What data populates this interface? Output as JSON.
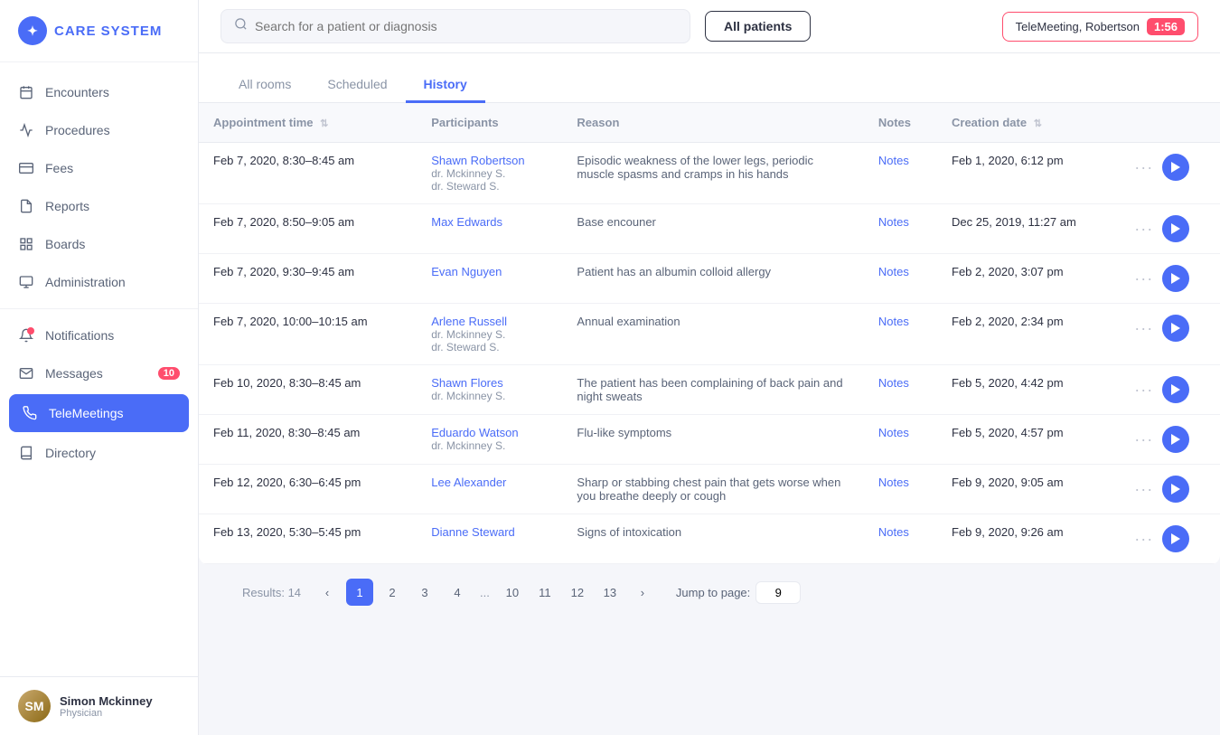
{
  "sidebar": {
    "logo_text": "CARE SYSTEM",
    "items": [
      {
        "id": "encounters",
        "label": "Encounters",
        "icon": "calendar-icon",
        "active": false
      },
      {
        "id": "procedures",
        "label": "Procedures",
        "icon": "activity-icon",
        "active": false
      },
      {
        "id": "fees",
        "label": "Fees",
        "icon": "card-icon",
        "active": false
      },
      {
        "id": "reports",
        "label": "Reports",
        "icon": "file-icon",
        "active": false
      },
      {
        "id": "boards",
        "label": "Boards",
        "icon": "grid-icon",
        "active": false
      },
      {
        "id": "administration",
        "label": "Administration",
        "icon": "monitor-icon",
        "active": false
      },
      {
        "id": "notifications",
        "label": "Notifications",
        "icon": "bell-icon",
        "active": false
      },
      {
        "id": "messages",
        "label": "Messages",
        "icon": "mail-icon",
        "active": false,
        "badge": "10"
      },
      {
        "id": "telemeetings",
        "label": "TeleMeetings",
        "icon": "phone-icon",
        "active": true
      },
      {
        "id": "directory",
        "label": "Directory",
        "icon": "book-icon",
        "active": false
      }
    ],
    "user": {
      "name": "Simon Mckinney",
      "role": "Physician",
      "initials": "SM"
    }
  },
  "topbar": {
    "search_placeholder": "Search for a patient or diagnosis",
    "all_patients_label": "All patients",
    "tele_meeting_label": "TeleMeeting, Robertson",
    "tele_timer": "1:56"
  },
  "tabs": [
    {
      "id": "all-rooms",
      "label": "All rooms",
      "active": false
    },
    {
      "id": "scheduled",
      "label": "Scheduled",
      "active": false
    },
    {
      "id": "history",
      "label": "History",
      "active": true
    }
  ],
  "table": {
    "columns": [
      {
        "id": "appointment-time",
        "label": "Appointment time",
        "sortable": true
      },
      {
        "id": "participants",
        "label": "Participants",
        "sortable": false
      },
      {
        "id": "reason",
        "label": "Reason",
        "sortable": false
      },
      {
        "id": "notes",
        "label": "Notes",
        "sortable": false
      },
      {
        "id": "creation-date",
        "label": "Creation date",
        "sortable": true
      },
      {
        "id": "actions",
        "label": "",
        "sortable": false
      }
    ],
    "rows": [
      {
        "appointment_time": "Feb 7, 2020, 8:30–8:45 am",
        "participants": "Shawn Robertson",
        "doctors": [
          "dr. Mckinney S.",
          "dr. Steward S."
        ],
        "reason": "Episodic weakness of the lower legs, periodic muscle spasms and cramps in his hands",
        "notes_label": "Notes",
        "creation_date": "Feb 1, 2020, 6:12 pm"
      },
      {
        "appointment_time": "Feb 7, 2020, 8:50–9:05 am",
        "participants": "Max Edwards",
        "doctors": [],
        "reason": "Base encouner",
        "notes_label": "Notes",
        "creation_date": "Dec 25, 2019, 11:27 am"
      },
      {
        "appointment_time": "Feb 7, 2020, 9:30–9:45 am",
        "participants": "Evan Nguyen",
        "doctors": [],
        "reason": "Patient has an albumin colloid allergy",
        "notes_label": "Notes",
        "creation_date": "Feb 2, 2020, 3:07 pm"
      },
      {
        "appointment_time": "Feb 7, 2020, 10:00–10:15 am",
        "participants": "Arlene Russell",
        "doctors": [
          "dr. Mckinney S.",
          "dr. Steward S."
        ],
        "reason": "Annual examination",
        "notes_label": "Notes",
        "creation_date": "Feb 2, 2020, 2:34 pm"
      },
      {
        "appointment_time": "Feb 10, 2020, 8:30–8:45 am",
        "participants": "Shawn Flores",
        "doctors": [
          "dr. Mckinney S."
        ],
        "reason": "The patient has been complaining of back pain and night sweats",
        "notes_label": "Notes",
        "creation_date": "Feb 5, 2020, 4:42 pm"
      },
      {
        "appointment_time": "Feb 11, 2020, 8:30–8:45 am",
        "participants": "Eduardo Watson",
        "doctors": [
          "dr. Mckinney S."
        ],
        "reason": "Flu-like symptoms",
        "notes_label": "Notes",
        "creation_date": "Feb 5, 2020, 4:57 pm"
      },
      {
        "appointment_time": "Feb 12, 2020, 6:30–6:45 pm",
        "participants": "Lee Alexander",
        "doctors": [],
        "reason": "Sharp or stabbing chest pain that gets worse when you breathe deeply or cough",
        "notes_label": "Notes",
        "creation_date": "Feb 9, 2020, 9:05 am"
      },
      {
        "appointment_time": "Feb 13, 2020, 5:30–5:45 pm",
        "participants": "Dianne Steward",
        "doctors": [],
        "reason": "Signs of intoxication",
        "notes_label": "Notes",
        "creation_date": "Feb 9, 2020, 9:26 am"
      }
    ]
  },
  "pagination": {
    "results_label": "Results: 14",
    "pages": [
      "1",
      "2",
      "3",
      "4",
      "...",
      "10",
      "11",
      "12",
      "13"
    ],
    "jump_label": "Jump to page:",
    "jump_value": "9",
    "prev_icon": "‹",
    "next_icon": "›"
  }
}
